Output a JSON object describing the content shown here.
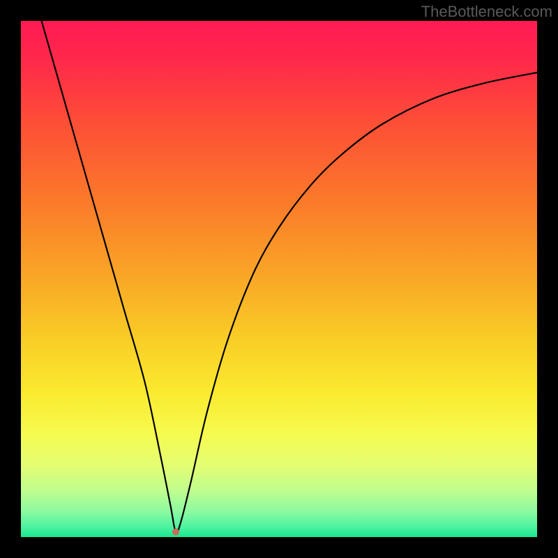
{
  "watermark": "TheBottleneck.com",
  "chart_data": {
    "type": "line",
    "title": "",
    "xlabel": "",
    "ylabel": "",
    "xlim": [
      0,
      100
    ],
    "ylim": [
      0,
      100
    ],
    "notes": "Bottleneck curve with V-shape dip. Minimum near x≈30. Background is vertical gradient red→orange→yellow→green. A small marker dot at the minimum.",
    "series": [
      {
        "name": "bottleneck-curve",
        "x": [
          4,
          8,
          12,
          16,
          20,
          24,
          27,
          29,
          30,
          31,
          33,
          36,
          40,
          45,
          50,
          56,
          62,
          70,
          80,
          90,
          100
        ],
        "y": [
          100,
          86,
          72,
          58,
          44,
          30,
          16,
          6,
          1,
          3,
          11,
          24,
          38,
          51,
          60,
          68,
          74,
          80,
          85,
          88,
          90
        ]
      }
    ],
    "marker": {
      "x": 30,
      "y": 1,
      "color": "#c76b5a",
      "radius": 5
    },
    "gradient_stops": [
      {
        "offset": 0.0,
        "color": "#ff1a53"
      },
      {
        "offset": 0.08,
        "color": "#ff2a4a"
      },
      {
        "offset": 0.2,
        "color": "#fd4f36"
      },
      {
        "offset": 0.35,
        "color": "#fb7a2a"
      },
      {
        "offset": 0.5,
        "color": "#f9a826"
      },
      {
        "offset": 0.62,
        "color": "#f9ce26"
      },
      {
        "offset": 0.72,
        "color": "#faea2f"
      },
      {
        "offset": 0.8,
        "color": "#f6fb4f"
      },
      {
        "offset": 0.86,
        "color": "#e4fd72"
      },
      {
        "offset": 0.91,
        "color": "#c0fd8e"
      },
      {
        "offset": 0.95,
        "color": "#8dfaa0"
      },
      {
        "offset": 0.98,
        "color": "#4ef2a1"
      },
      {
        "offset": 1.0,
        "color": "#17e88e"
      }
    ],
    "curve_color": "#000000",
    "curve_width": 2.2
  }
}
